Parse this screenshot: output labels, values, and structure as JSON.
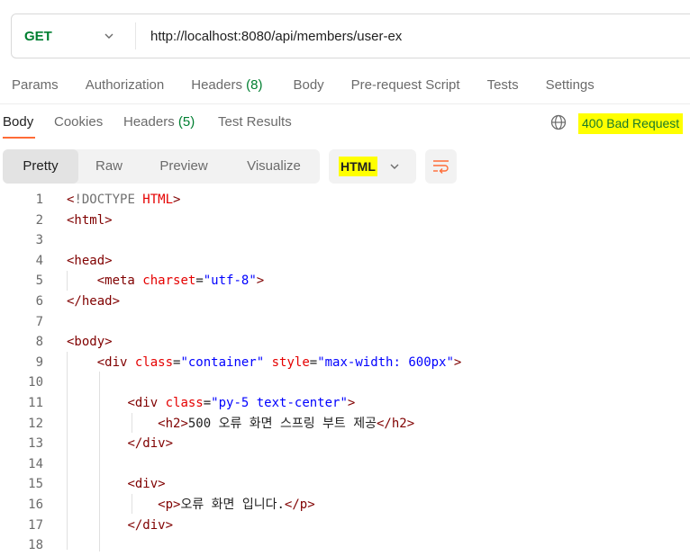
{
  "request": {
    "method": "GET",
    "url": "http://localhost:8080/api/members/user-ex"
  },
  "request_tabs": [
    {
      "label": "Params"
    },
    {
      "label": "Authorization"
    },
    {
      "label": "Headers",
      "count": "(8)"
    },
    {
      "label": "Body"
    },
    {
      "label": "Pre-request Script"
    },
    {
      "label": "Tests"
    },
    {
      "label": "Settings"
    }
  ],
  "response": {
    "tabs": [
      {
        "label": "Body"
      },
      {
        "label": "Cookies"
      },
      {
        "label": "Headers",
        "count": "(5)"
      },
      {
        "label": "Test Results"
      }
    ],
    "status": "400 Bad Request",
    "status_highlight": "#ffff00",
    "view_modes": [
      "Pretty",
      "Raw",
      "Preview",
      "Visualize"
    ],
    "selected_view": "Pretty",
    "format": "HTML"
  },
  "colors": {
    "accent": "#ff6c37",
    "method_green": "#007f31"
  },
  "code": {
    "line_numbers": [
      "1",
      "2",
      "3",
      "4",
      "5",
      "6",
      "7",
      "8",
      "9",
      "10",
      "11",
      "12",
      "13",
      "14",
      "15",
      "16",
      "17",
      "18"
    ],
    "lines": [
      [
        {
          "t": "<",
          "c": "tag"
        },
        {
          "t": "!DOCTYPE",
          "c": "doc"
        },
        {
          "t": " HTML",
          "c": "attr"
        },
        {
          "t": ">",
          "c": "tag"
        }
      ],
      [
        {
          "t": "<html>",
          "c": "tag"
        }
      ],
      [],
      [
        {
          "t": "<head>",
          "c": "tag"
        }
      ],
      [
        {
          "t": "    "
        },
        {
          "t": "<meta",
          "c": "tag"
        },
        {
          "t": " charset",
          "c": "attr"
        },
        {
          "t": "=",
          "c": "pl"
        },
        {
          "t": "\"utf-8\"",
          "c": "val"
        },
        {
          "t": ">",
          "c": "tag"
        }
      ],
      [
        {
          "t": "</head>",
          "c": "tag"
        }
      ],
      [],
      [
        {
          "t": "<body>",
          "c": "tag"
        }
      ],
      [
        {
          "t": "    "
        },
        {
          "t": "<div",
          "c": "tag"
        },
        {
          "t": " class",
          "c": "attr"
        },
        {
          "t": "=",
          "c": "pl"
        },
        {
          "t": "\"container\"",
          "c": "val"
        },
        {
          "t": " style",
          "c": "attr"
        },
        {
          "t": "=",
          "c": "pl"
        },
        {
          "t": "\"max-width: 600px\"",
          "c": "val"
        },
        {
          "t": ">",
          "c": "tag"
        }
      ],
      [],
      [
        {
          "t": "        "
        },
        {
          "t": "<div",
          "c": "tag"
        },
        {
          "t": " class",
          "c": "attr"
        },
        {
          "t": "=",
          "c": "pl"
        },
        {
          "t": "\"py-5 text-center\"",
          "c": "val"
        },
        {
          "t": ">",
          "c": "tag"
        }
      ],
      [
        {
          "t": "            "
        },
        {
          "t": "<h2>",
          "c": "tag"
        },
        {
          "t": "500 오류 화면 스프링 부트 제공",
          "c": "pl"
        },
        {
          "t": "</h2>",
          "c": "tag"
        }
      ],
      [
        {
          "t": "        "
        },
        {
          "t": "</div>",
          "c": "tag"
        }
      ],
      [],
      [
        {
          "t": "        "
        },
        {
          "t": "<div>",
          "c": "tag"
        }
      ],
      [
        {
          "t": "            "
        },
        {
          "t": "<p>",
          "c": "tag"
        },
        {
          "t": "오류 화면 입니다.",
          "c": "pl"
        },
        {
          "t": "</p>",
          "c": "tag"
        }
      ],
      [
        {
          "t": "        "
        },
        {
          "t": "</div>",
          "c": "tag"
        }
      ],
      []
    ]
  }
}
